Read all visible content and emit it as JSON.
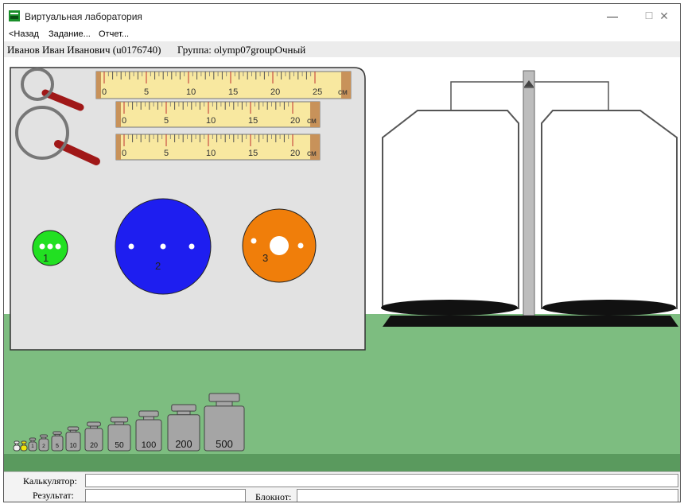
{
  "window": {
    "title": "Виртуальная лаборатория",
    "minimize_glyph": "—",
    "maximize_glyph": "☐",
    "close_glyph": "✕"
  },
  "menu": {
    "back": "<Назад",
    "task": "Задание...",
    "report": "Отчет..."
  },
  "user": {
    "name": "Иванов Иван Иванович (u0176740)",
    "group": "Группа: olymp07groupОчный"
  },
  "rulers": [
    {
      "labels": [
        "0",
        "5",
        "10",
        "15",
        "20",
        "25"
      ],
      "unit": "см"
    },
    {
      "labels": [
        "0",
        "5",
        "10",
        "15",
        "20"
      ],
      "unit": "см"
    },
    {
      "labels": [
        "0",
        "5",
        "10",
        "15",
        "20"
      ],
      "unit": "см"
    }
  ],
  "disks": [
    {
      "number": "1",
      "color": "#22e022"
    },
    {
      "number": "2",
      "color": "#1e1ef0"
    },
    {
      "number": "3",
      "color": "#f07e0a"
    }
  ],
  "weights": [
    {
      "label": "",
      "color": "#f0f0f0"
    },
    {
      "label": "",
      "color": "#f0e60a"
    },
    {
      "label": "1",
      "color": "#a5a5a5"
    },
    {
      "label": "2",
      "color": "#a5a5a5"
    },
    {
      "label": "5",
      "color": "#a5a5a5"
    },
    {
      "label": "10",
      "color": "#a5a5a5"
    },
    {
      "label": "20",
      "color": "#a5a5a5"
    },
    {
      "label": "50",
      "color": "#a5a5a5"
    },
    {
      "label": "100",
      "color": "#a5a5a5"
    },
    {
      "label": "200",
      "color": "#a5a5a5"
    },
    {
      "label": "500",
      "color": "#a5a5a5"
    }
  ],
  "bottom": {
    "calculator_label": "Калькулятор:",
    "calculator_value": "",
    "result_label": "Результат:",
    "result_value": "",
    "notepad_label": "Блокнот:",
    "notepad_value": ""
  },
  "colors": {
    "table": "#7dbd80",
    "table_edge": "#5a9a5e",
    "panel": "#e2e2e2",
    "ruler": "#f8e8a0",
    "ruler_end": "#c8925a",
    "magnifier_handle": "#a01818"
  }
}
